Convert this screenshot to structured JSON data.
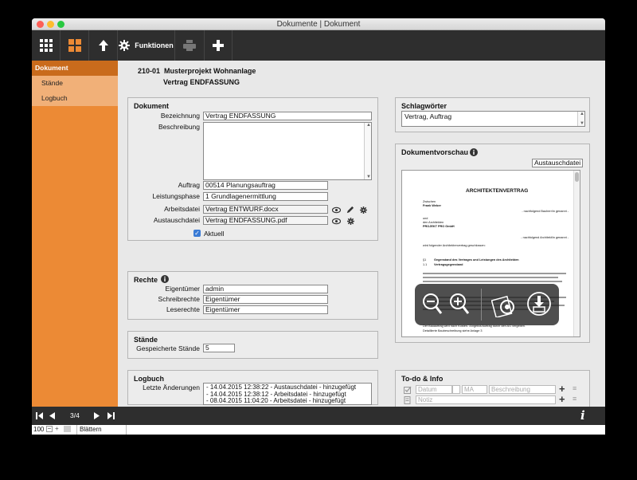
{
  "window": {
    "title": "Dokumente | Dokument"
  },
  "toolbar": {
    "functions_label": "Funktionen"
  },
  "sidebar": {
    "items": [
      {
        "label": "Dokument"
      },
      {
        "label": "Stände"
      },
      {
        "label": "Logbuch"
      }
    ]
  },
  "header": {
    "number": "210-01",
    "project": "Musterprojekt Wohnanlage",
    "document": "Vertrag ENDFASSUNG"
  },
  "dokument": {
    "title": "Dokument",
    "bezeichnung_label": "Bezeichnung",
    "bezeichnung": "Vertrag ENDFASSUNG",
    "beschreibung_label": "Beschreibung",
    "beschreibung": "",
    "auftrag_label": "Auftrag",
    "auftrag": "00514 Planungsauftrag",
    "leistungsphase_label": "Leistungsphase",
    "leistungsphase": "1 Grundlagenermittlung",
    "arbeitsdatei_label": "Arbeitsdatei",
    "arbeitsdatei": "Vertrag ENTWURF.docx",
    "austauschdatei_label": "Austauschdatei",
    "austauschdatei": "Vertrag ENDFASSUNG.pdf",
    "aktuell_label": "Aktuell",
    "aktuell_checked": true
  },
  "rechte": {
    "title": "Rechte",
    "eigentuemer_label": "Eigentümer",
    "eigentuemer": "admin",
    "schreibrechte_label": "Schreibrechte",
    "schreibrechte": "Eigentümer",
    "leserechte_label": "Leserechte",
    "leserechte": "Eigentümer"
  },
  "staende": {
    "title": "Stände",
    "gespeicherte_label": "Gespeicherte Stände",
    "gespeicherte": "5"
  },
  "logbuch": {
    "title": "Logbuch",
    "letzte_label": "Letzte Änderungen",
    "entries": [
      "- 14.04.2015 12:38:22 - Austauschdatei - hinzugefügt",
      "- 14.04.2015 12:38:12 - Arbeitsdatei - hinzugefügt",
      "- 08.04.2015 11:04:20 - Arbeitsdatei - hinzugefügt"
    ]
  },
  "schlagwoerter": {
    "title": "Schlagwörter",
    "value": "Vertrag, Auftrag"
  },
  "vorschau": {
    "title": "Dokumentvorschau",
    "select": "Austauschdatei",
    "doc": {
      "heading": "ARCHITEKTENVERTRAG",
      "zwischen": "Zwischen",
      "name": "Frank Weber",
      "und": "und",
      "den_architekten": "den Architekten",
      "firma": "PROJEKT PRO GmbH",
      "wird": "wird folgender Architektenvertrag geschlossen:",
      "s1": "§1",
      "s1_title": "Gegenstand des Vertrages und Leistungen des Architekten",
      "s11": "1.1",
      "s11_title": "Vertragsgegenstand",
      "right1": "- nachfolgend Bauherr/in genannt -",
      "right2": "- nachfolgend Architekt/in genannt -",
      "bottom1": "Der Bauauftrag wird nach Kosten- /Angebot/Auftrag durch den AG vergeben.",
      "bottom2": "Detaillierte Baubeschreibung siehe Anlage 3"
    }
  },
  "todo": {
    "title": "To-do & Info",
    "datum": "Datum",
    "ma": "MA",
    "beschreibung": "Beschreibung",
    "notiz": "Notiz"
  },
  "nav": {
    "page": "3/4"
  },
  "status": {
    "zoom": "100",
    "mode": "Blättern"
  },
  "colors": {
    "accent": "#ec8a35",
    "accent_dark": "#c96b1c",
    "toolbar": "#2e2e2e"
  }
}
